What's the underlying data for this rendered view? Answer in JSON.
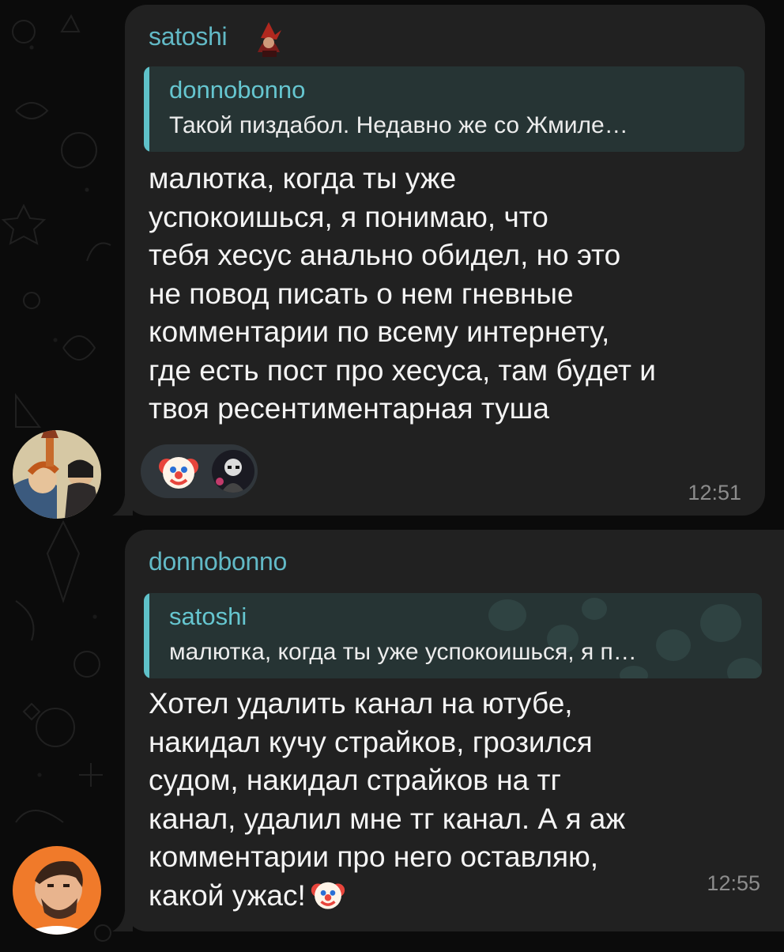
{
  "messages": [
    {
      "sender": "satoshi",
      "reply": {
        "author": "donnobonno",
        "text": "Такой пиздабол. Недавно же со Жмиле…"
      },
      "text": "малютка, когда ты уже\nуспокоишься, я понимаю, что\nтебя хесус анально обидел, но это\nне повод писать о нем гневные\nкомментарии по всему интернету,\nгде есть пост про хесуса, там будет и\nтвоя ресентиментарная туша",
      "reactions": [
        "clown-emoji",
        "user-avatar-reaction"
      ],
      "time": "12:51"
    },
    {
      "sender": "donnobonno",
      "reply": {
        "author": "satoshi",
        "text": "малютка, когда ты уже успокоишься, я п…"
      },
      "text": "Хотел удалить канал на ютубе,\nнакидал кучу страйков, грозился\nсудом, накидал страйков на тг\nканал, удалил мне тг канал. А я аж\nкомментарии про него оставляю,\nкакой ужас!",
      "trailing_emoji": "clown-emoji",
      "time": "12:55"
    }
  ],
  "colors": {
    "bubble": "#212121",
    "accent_name": "#62b9c6",
    "quote_bg": "#263434",
    "quote_bar": "#5fc1c9",
    "text": "#f4f4f4",
    "time": "#8c8c8c",
    "background": "#0b0b0b"
  }
}
